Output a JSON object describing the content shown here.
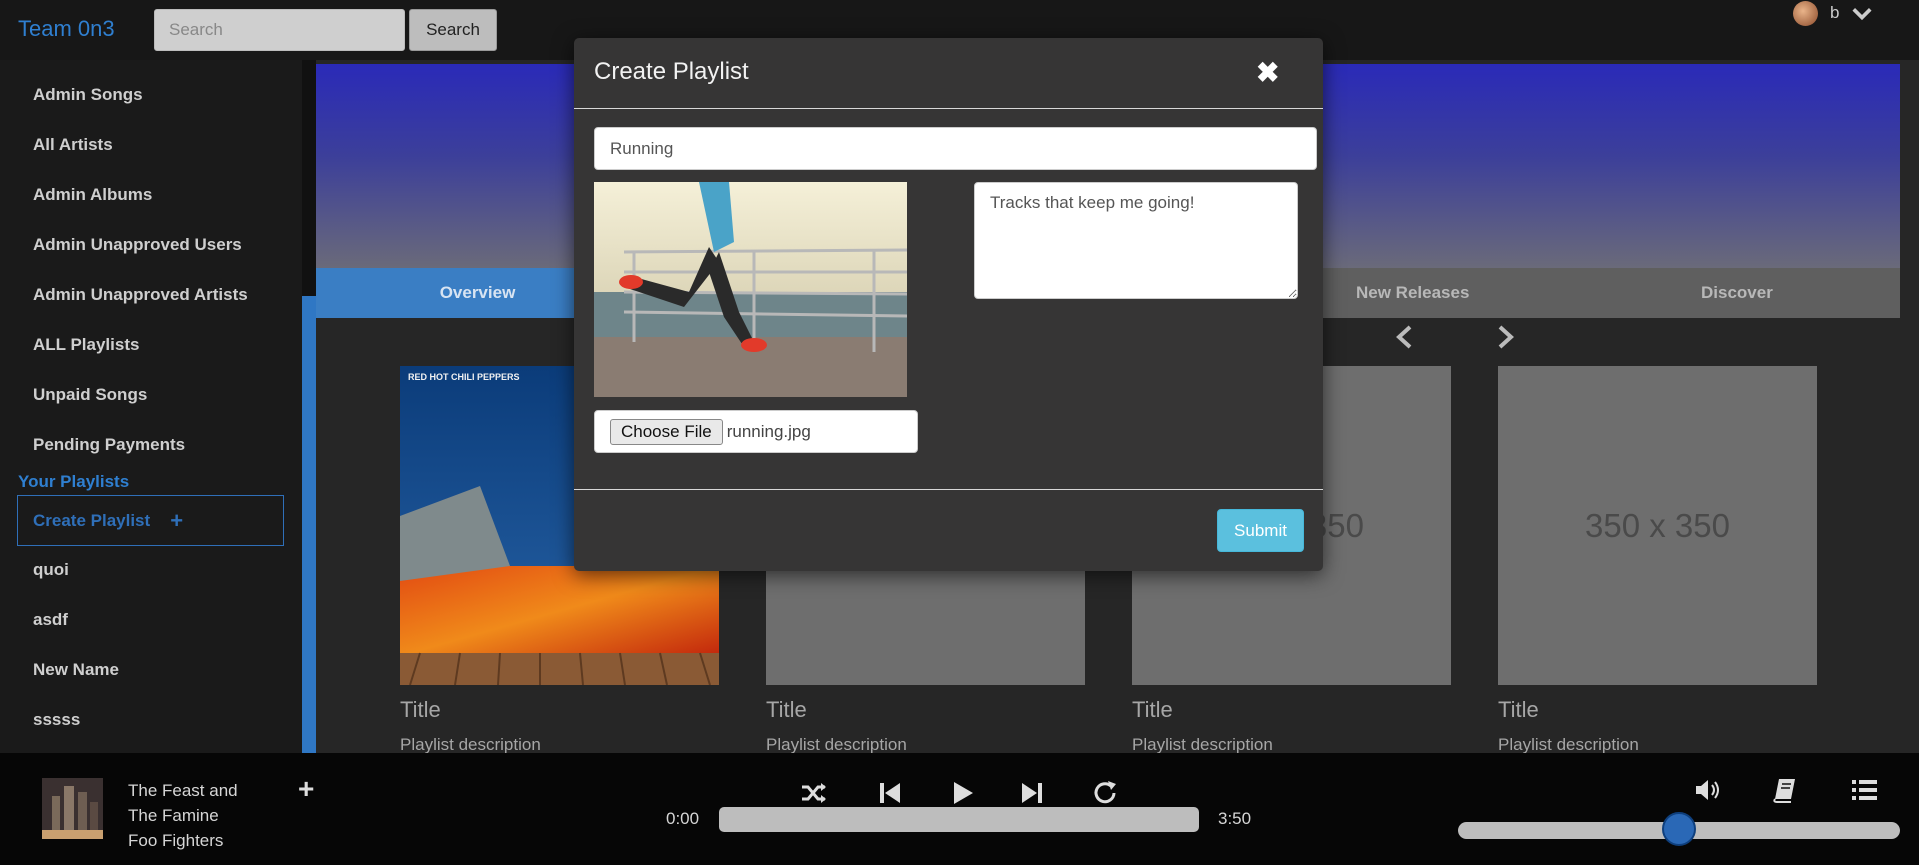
{
  "app": {
    "brand": "Team 0n3"
  },
  "search": {
    "placeholder": "Search",
    "button_label": "Search"
  },
  "user": {
    "name": "b"
  },
  "sidebar": {
    "items": [
      {
        "label": "Admin Songs"
      },
      {
        "label": "All Artists"
      },
      {
        "label": "Admin Albums"
      },
      {
        "label": "Admin Unapproved Users"
      },
      {
        "label": "Admin Unapproved Artists"
      },
      {
        "label": "ALL Playlists"
      },
      {
        "label": "Unpaid Songs"
      },
      {
        "label": "Pending Payments"
      }
    ],
    "your_playlists_heading": "Your Playlists",
    "create_playlist_label": "Create Playlist",
    "create_playlist_icon": "plus-icon",
    "playlists": [
      {
        "label": "quoi"
      },
      {
        "label": "asdf"
      },
      {
        "label": "New Name"
      },
      {
        "label": "sssss"
      }
    ]
  },
  "tabs": {
    "overview": "Overview",
    "new_releases": "New Releases",
    "discover": "Discover"
  },
  "cards": [
    {
      "title": "Title",
      "description": "Playlist description",
      "placeholder": "",
      "art_text": "RED HOT CHILI PEPPERS"
    },
    {
      "title": "Title",
      "description": "Playlist description",
      "placeholder": ""
    },
    {
      "title": "Title",
      "description": "Playlist description",
      "placeholder": "350 x 350"
    },
    {
      "title": "Title",
      "description": "Playlist description",
      "placeholder": "350 x 350"
    }
  ],
  "modal": {
    "title": "Create Playlist",
    "close_icon": "close-icon",
    "name_value": "Running",
    "description_value": "Tracks that keep me going!",
    "file_button": "Choose File",
    "file_name": "running.jpg",
    "submit_label": "Submit"
  },
  "player": {
    "song_title_line1": "The Feast and",
    "song_title_line2": "The Famine",
    "artist": "Foo Fighters",
    "current_time": "0:00",
    "duration": "3:50",
    "progress_fraction": 0,
    "volume_fraction": 0.5
  },
  "colors": {
    "accent": "#2f7fd0",
    "submit": "#5bc0de",
    "tab_active": "#3a7ec4"
  }
}
